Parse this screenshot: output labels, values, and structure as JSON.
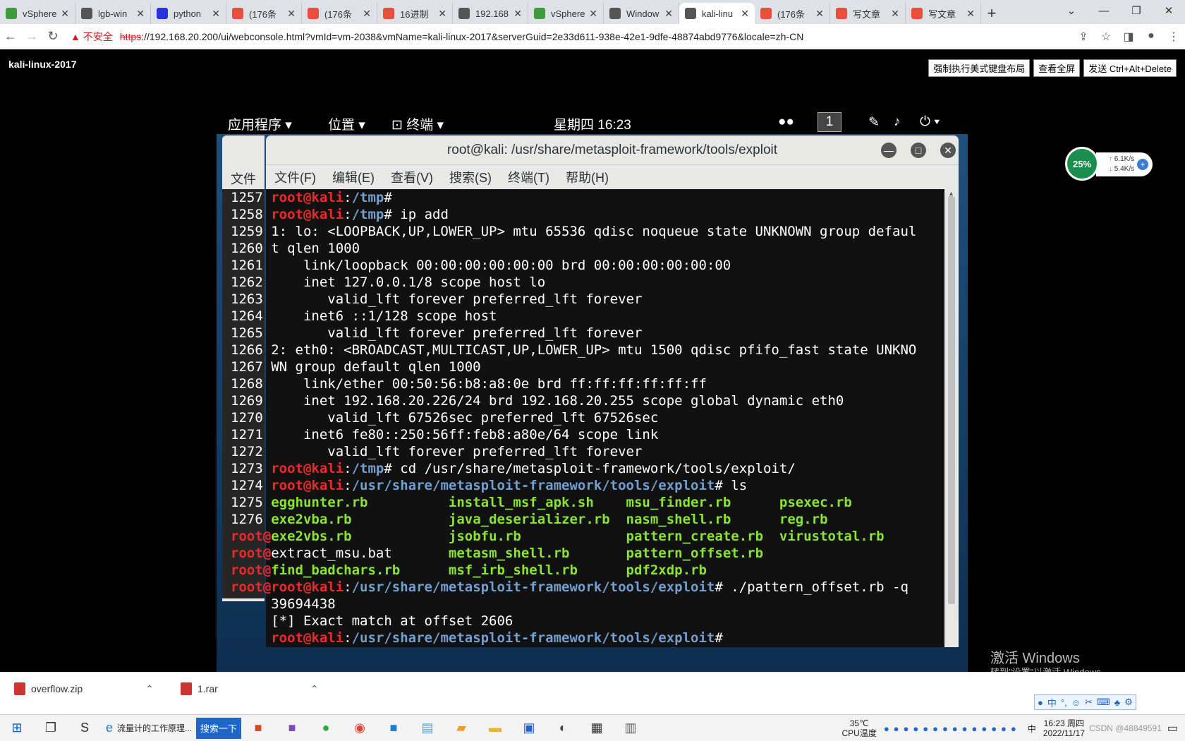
{
  "browser": {
    "tabs": [
      {
        "label": "vSphere",
        "icon": "vsphere-icon",
        "color": "#3d9a3d"
      },
      {
        "label": "lgb-win",
        "icon": "globe-icon",
        "color": "#555555"
      },
      {
        "label": "python",
        "icon": "baidu-icon",
        "color": "#2932e1"
      },
      {
        "label": "(176条",
        "icon": "csdn-icon",
        "color": "#e94e3d"
      },
      {
        "label": "(176条",
        "icon": "csdn-icon",
        "color": "#e94e3d"
      },
      {
        "label": "16进制",
        "icon": "converter-icon",
        "color": "#e94e3d"
      },
      {
        "label": "192.168",
        "icon": "globe-icon",
        "color": "#555555"
      },
      {
        "label": "vSphere",
        "icon": "vsphere-icon",
        "color": "#3d9a3d"
      },
      {
        "label": "Window",
        "icon": "globe-icon",
        "color": "#555555"
      },
      {
        "label": "kali-linu",
        "icon": "globe-icon",
        "color": "#555555"
      },
      {
        "label": "(176条",
        "icon": "csdn-icon",
        "color": "#e94e3d"
      },
      {
        "label": "写文章",
        "icon": "csdn-icon",
        "color": "#e94e3d"
      },
      {
        "label": "写文章",
        "icon": "csdn-icon",
        "color": "#e94e3d"
      }
    ],
    "active_tab": 9,
    "new_tab": "+",
    "address": {
      "warning_icon": "▲",
      "insecure_label": "不安全",
      "scheme": "https",
      "rest": "://192.168.20.200/ui/webconsole.html?vmId=vm-2038&vmName=kali-linux-2017&serverGuid=2e33d611-938e-42e1-9dfe-48874abd9776&locale=zh-CN"
    }
  },
  "vm": {
    "name": "kali-linux-2017",
    "buttons": [
      "强制执行美式键盘布局",
      "查看全屏",
      "发送 Ctrl+Alt+Delete"
    ]
  },
  "gnome": {
    "applications": "应用程序",
    "places": "位置",
    "terminal": "终端",
    "clock": "星期四 16:23",
    "workspace": "1"
  },
  "bg_window": {
    "menu": "文件(F"
  },
  "terminal": {
    "title": "root@kali: /usr/share/metasploit-framework/tools/exploit",
    "menu": [
      "文件(F)",
      "编辑(E)",
      "查看(V)",
      "搜索(S)",
      "终端(T)",
      "帮助(H)"
    ],
    "lines": [
      [
        {
          "t": "1257 ",
          "c": ""
        },
        {
          "t": "root@kali",
          "c": "r"
        },
        {
          "t": ":",
          "c": ""
        },
        {
          "t": "/tmp",
          "c": "b"
        },
        {
          "t": "# ",
          "c": ""
        }
      ],
      [
        {
          "t": "1258 ",
          "c": ""
        },
        {
          "t": "root@kali",
          "c": "r"
        },
        {
          "t": ":",
          "c": ""
        },
        {
          "t": "/tmp",
          "c": "b"
        },
        {
          "t": "# ip add",
          "c": ""
        }
      ],
      [
        {
          "t": "1259 ",
          "c": ""
        },
        {
          "t": "1: lo: <LOOPBACK,UP,LOWER_UP> mtu 65536 qdisc noqueue state UNKNOWN group defaul",
          "c": ""
        }
      ],
      [
        {
          "t": "1260 ",
          "c": ""
        },
        {
          "t": "t qlen 1000",
          "c": ""
        }
      ],
      [
        {
          "t": "1261 ",
          "c": ""
        },
        {
          "t": "    link/loopback 00:00:00:00:00:00 brd 00:00:00:00:00:00",
          "c": ""
        }
      ],
      [
        {
          "t": "1262 ",
          "c": ""
        },
        {
          "t": "    inet 127.0.0.1/8 scope host lo",
          "c": ""
        }
      ],
      [
        {
          "t": "1263 ",
          "c": ""
        },
        {
          "t": "       valid_lft forever preferred_lft forever",
          "c": ""
        }
      ],
      [
        {
          "t": "1264 ",
          "c": ""
        },
        {
          "t": "    inet6 ::1/128 scope host",
          "c": ""
        }
      ],
      [
        {
          "t": "1265 ",
          "c": ""
        },
        {
          "t": "       valid_lft forever preferred_lft forever",
          "c": ""
        }
      ],
      [
        {
          "t": "1266 ",
          "c": ""
        },
        {
          "t": "2: eth0: <BROADCAST,MULTICAST,UP,LOWER_UP> mtu 1500 qdisc pfifo_fast state UNKNO",
          "c": ""
        }
      ],
      [
        {
          "t": "1267 ",
          "c": ""
        },
        {
          "t": "WN group default qlen 1000",
          "c": ""
        }
      ],
      [
        {
          "t": "1268 ",
          "c": ""
        },
        {
          "t": "    link/ether 00:50:56:b8:a8:0e brd ff:ff:ff:ff:ff:ff",
          "c": ""
        }
      ],
      [
        {
          "t": "1269 ",
          "c": ""
        },
        {
          "t": "    inet 192.168.20.226/24 brd 192.168.20.255 scope global dynamic eth0",
          "c": ""
        }
      ],
      [
        {
          "t": "1270 ",
          "c": ""
        },
        {
          "t": "       valid_lft 67526sec preferred_lft 67526sec",
          "c": ""
        }
      ],
      [
        {
          "t": "1271 ",
          "c": ""
        },
        {
          "t": "    inet6 fe80::250:56ff:feb8:a80e/64 scope link",
          "c": ""
        }
      ],
      [
        {
          "t": "1272 ",
          "c": ""
        },
        {
          "t": "       valid_lft forever preferred_lft forever",
          "c": ""
        }
      ],
      [
        {
          "t": "1273 ",
          "c": ""
        },
        {
          "t": "root@kali",
          "c": "r"
        },
        {
          "t": ":",
          "c": ""
        },
        {
          "t": "/tmp",
          "c": "b"
        },
        {
          "t": "# cd /usr/share/metasploit-framework/tools/exploit/",
          "c": ""
        }
      ],
      [
        {
          "t": "1274 ",
          "c": ""
        },
        {
          "t": "root@kali",
          "c": "r"
        },
        {
          "t": ":",
          "c": ""
        },
        {
          "t": "/usr/share/metasploit-framework/tools/exploit",
          "c": "b"
        },
        {
          "t": "# ls",
          "c": ""
        }
      ],
      [
        {
          "t": "1275 ",
          "c": ""
        },
        {
          "t": "egghunter.rb",
          "c": "g"
        },
        {
          "t": "          ",
          "c": ""
        },
        {
          "t": "install_msf_apk.sh",
          "c": "g"
        },
        {
          "t": "    ",
          "c": ""
        },
        {
          "t": "msu_finder.rb",
          "c": "g"
        },
        {
          "t": "      ",
          "c": ""
        },
        {
          "t": "psexec.rb",
          "c": "g"
        }
      ],
      [
        {
          "t": "1276 ",
          "c": ""
        },
        {
          "t": "exe2vba.rb",
          "c": "g"
        },
        {
          "t": "            ",
          "c": ""
        },
        {
          "t": "java_deserializer.rb",
          "c": "g"
        },
        {
          "t": "  ",
          "c": ""
        },
        {
          "t": "nasm_shell.rb",
          "c": "g"
        },
        {
          "t": "      ",
          "c": ""
        },
        {
          "t": "reg.rb",
          "c": "g"
        }
      ],
      [
        {
          "t": "root@",
          "c": "r"
        },
        {
          "t": "exe2vbs.rb",
          "c": "g"
        },
        {
          "t": "            ",
          "c": ""
        },
        {
          "t": "jsobfu.rb",
          "c": "g"
        },
        {
          "t": "             ",
          "c": ""
        },
        {
          "t": "pattern_create.rb",
          "c": "g"
        },
        {
          "t": "  ",
          "c": ""
        },
        {
          "t": "virustotal.rb",
          "c": "g"
        }
      ],
      [
        {
          "t": "root@",
          "c": "r"
        },
        {
          "t": "extract_msu.bat       ",
          "c": ""
        },
        {
          "t": "metasm_shell.rb",
          "c": "g"
        },
        {
          "t": "       ",
          "c": ""
        },
        {
          "t": "pattern_offset.rb",
          "c": "g"
        }
      ],
      [
        {
          "t": "root@",
          "c": "r"
        },
        {
          "t": "find_badchars.rb",
          "c": "g"
        },
        {
          "t": "      ",
          "c": ""
        },
        {
          "t": "msf_irb_shell.rb",
          "c": "g"
        },
        {
          "t": "      ",
          "c": ""
        },
        {
          "t": "pdf2xdp.rb",
          "c": "g"
        }
      ],
      [
        {
          "t": "root@",
          "c": "r"
        },
        {
          "t": "root@kali",
          "c": "r"
        },
        {
          "t": ":",
          "c": ""
        },
        {
          "t": "/usr/share/metasploit-framework/tools/exploit",
          "c": "b"
        },
        {
          "t": "# ./pattern_offset.rb -q",
          "c": ""
        }
      ],
      [
        {
          "t": "     ",
          "c": ""
        },
        {
          "t": "39694438",
          "c": ""
        }
      ],
      [
        {
          "t": "     ",
          "c": ""
        },
        {
          "t": "[*] Exact match at offset 2606",
          "c": ""
        }
      ],
      [
        {
          "t": "     ",
          "c": ""
        },
        {
          "t": "root@kali",
          "c": "r"
        },
        {
          "t": ":",
          "c": ""
        },
        {
          "t": "/usr/share/metasploit-framework/tools/exploit",
          "c": "b"
        },
        {
          "t": "# ",
          "c": ""
        }
      ]
    ]
  },
  "netwidget": {
    "percent": "25%",
    "up": "6.1K/s",
    "down": "5.4K/s",
    "plus": "+"
  },
  "watermark": {
    "line1": "激活 Windows",
    "line2": "转到\"设置\"以激活 Windows。"
  },
  "downloads": [
    {
      "name": "overflow.zip"
    },
    {
      "name": "1.rar"
    }
  ],
  "taskbar": {
    "ie_label": "流量计的工作原理...",
    "search_label": "搜索一下",
    "temperature": "35℃",
    "temperature_label": "CPU温度",
    "ime_label": "中",
    "time": "16:23 周四",
    "date": "2022/11/17",
    "watermark_small": "CSDN @48849591"
  }
}
